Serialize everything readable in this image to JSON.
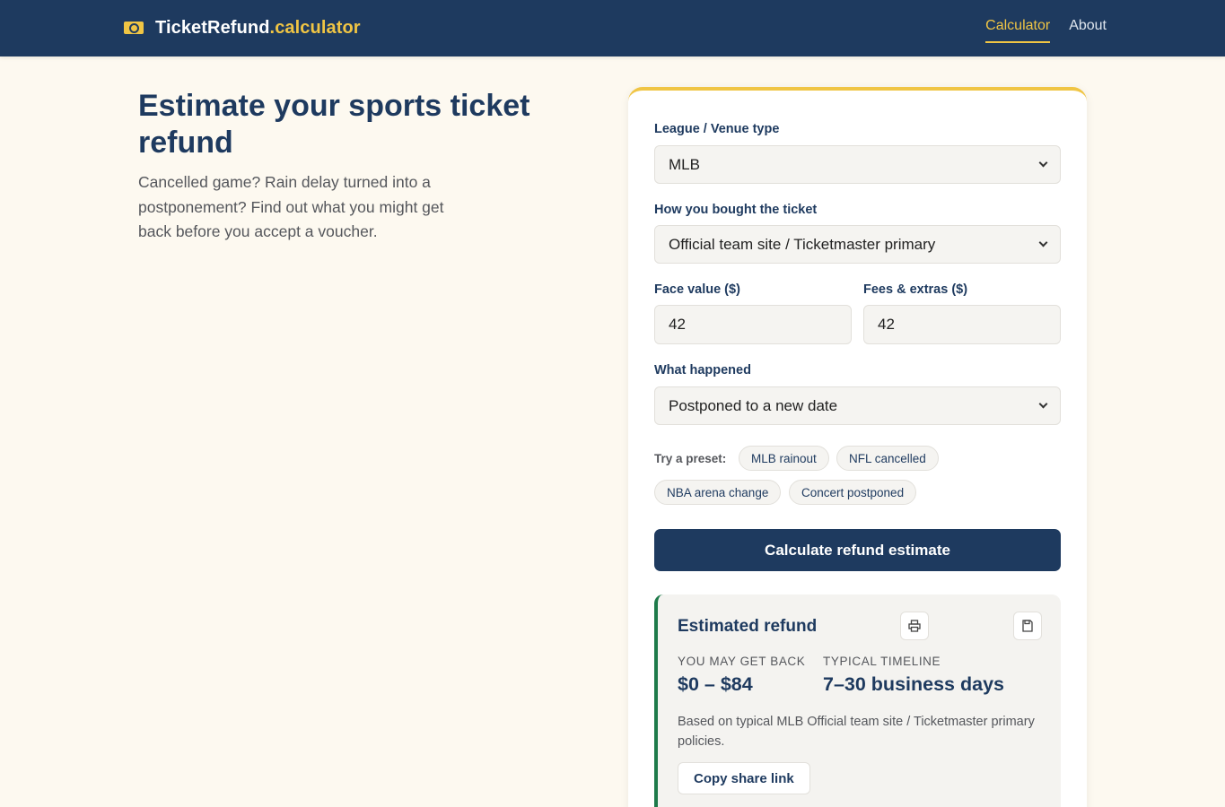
{
  "brand": {
    "icon": "ticket-icon",
    "name": "TicketRefund",
    "suffix": ".calculator"
  },
  "nav": {
    "items": [
      {
        "label": "Calculator",
        "active": true
      },
      {
        "label": "About",
        "active": false
      }
    ]
  },
  "hero": {
    "title": "Estimate your sports ticket refund",
    "subtitle": "Cancelled game? Rain delay turned into a postponement? Find out what you might get back before you accept a voucher."
  },
  "form": {
    "league": {
      "label": "League / Venue type",
      "value": "MLB"
    },
    "purchase": {
      "label": "How you bought the ticket",
      "value": "Official team site / Ticketmaster primary"
    },
    "face_value": {
      "label": "Face value ($)",
      "value": "42"
    },
    "fees": {
      "label": "Fees & extras ($)",
      "value": "42"
    },
    "happened": {
      "label": "What happened",
      "value": "Postponed to a new date"
    },
    "presets": {
      "label": "Try a preset:",
      "items": [
        "MLB rainout",
        "NFL cancelled",
        "NBA arena change",
        "Concert postponed"
      ]
    },
    "submit_label": "Calculate refund estimate"
  },
  "result": {
    "title": "Estimated refund",
    "icons": [
      "print-icon",
      "save-icon"
    ],
    "get_back_label": "YOU MAY GET BACK",
    "get_back_value": "$0 – $84",
    "timeline_label": "TYPICAL TIMELINE",
    "timeline_value": "7–30 business days",
    "note": "Based on typical MLB Official team site / Ticketmaster primary policies.",
    "share_label": "Copy share link"
  },
  "colors": {
    "navy": "#1e3a5f",
    "gold": "#f0c544",
    "green": "#1e7a4a",
    "background": "#fdf9f0"
  }
}
